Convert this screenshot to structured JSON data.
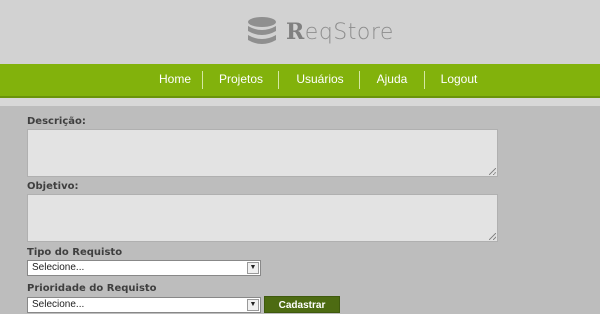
{
  "app": {
    "title_prefix": "R",
    "title_rest": "eqStore"
  },
  "nav": [
    {
      "label": "Home"
    },
    {
      "label": "Projetos"
    },
    {
      "label": "Usuários"
    },
    {
      "label": "Ajuda"
    },
    {
      "label": "Logout"
    }
  ],
  "form": {
    "descricao_label": "Descrição:",
    "objetivo_label": "Objetivo:",
    "tipo_label": "Tipo do Requisto",
    "tipo_value": "Selecione...",
    "prioridade_label": "Prioridade do Requisto",
    "prioridade_value": "Selecione...",
    "submit_label": "Cadastrar"
  },
  "icons": {
    "logo": "database-icon",
    "select_arrow": "triangle-down-icon"
  },
  "colors": {
    "nav": "#82b20c",
    "button": "#4d6b12",
    "header": "#d2d2d2"
  }
}
